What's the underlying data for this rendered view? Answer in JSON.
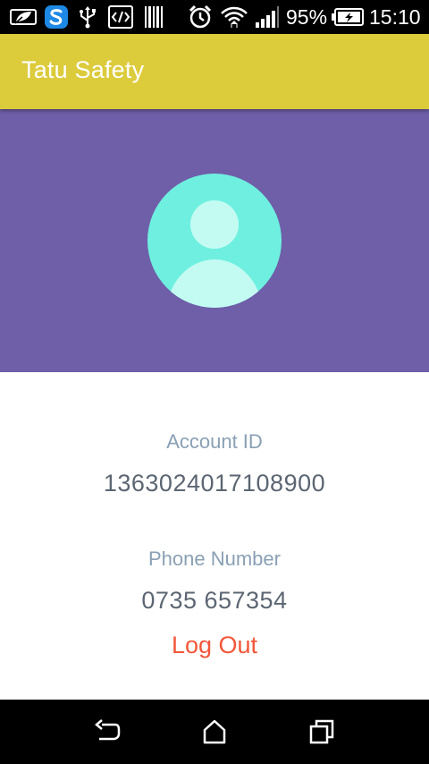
{
  "status_bar": {
    "battery_percent": "95%",
    "time": "15:10",
    "icons": [
      "leaf-icon",
      "s-app-icon",
      "usb-icon",
      "code-icon",
      "barcode-icon",
      "alarm-icon",
      "wifi-icon",
      "signal-icon",
      "battery-charging-icon"
    ]
  },
  "app_bar": {
    "title": "Tatu Safety",
    "color": "#DCCB3B"
  },
  "profile": {
    "header_color": "#6F5EA8",
    "avatar_icon": "user-avatar-icon",
    "account_id_label": "Account ID",
    "account_id": "1363024017108900",
    "phone_label": "Phone Number",
    "phone": "0735 657354",
    "logout_label": "Log Out",
    "logout_color": "#F2573A"
  },
  "nav_bar": {
    "buttons": [
      "back-icon",
      "home-icon",
      "recents-icon"
    ]
  }
}
